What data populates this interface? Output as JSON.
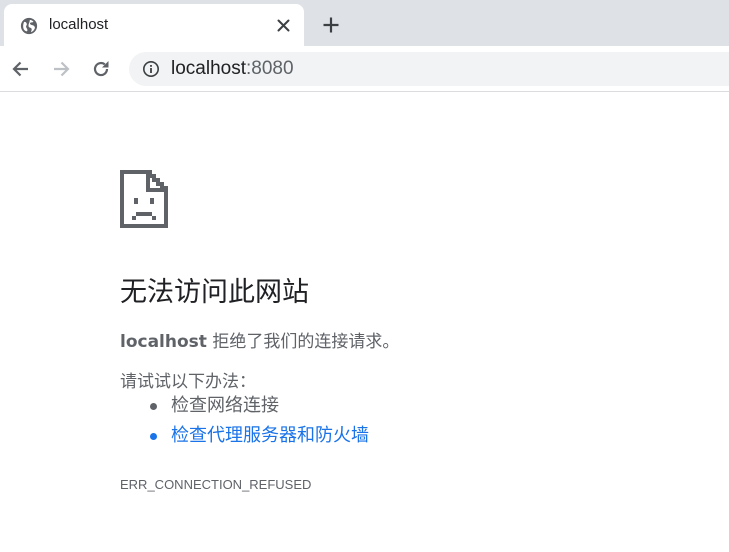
{
  "tab": {
    "title": "localhost",
    "favicon": "globe-icon",
    "close_icon": "close-icon"
  },
  "new_tab_icon": "plus-icon",
  "toolbar": {
    "back_icon": "arrow-left-icon",
    "forward_icon": "arrow-right-icon",
    "reload_icon": "reload-icon",
    "security_icon": "info-icon",
    "url_host": "localhost",
    "url_port": ":8080"
  },
  "error": {
    "icon": "sad-page-icon",
    "heading": "无法访问此网站",
    "host": "localhost",
    "summary_rest": " 拒绝了我们的连接请求。",
    "suggestions_intro": "请试试以下办法：",
    "suggestions": [
      {
        "text": "检查网络连接",
        "is_link": false
      },
      {
        "text": "检查代理服务器和防火墙",
        "is_link": true
      }
    ],
    "code": "ERR_CONNECTION_REFUSED"
  },
  "colors": {
    "tabstrip_bg": "#dee1e6",
    "text_primary": "#202124",
    "text_secondary": "#5f6368",
    "link": "#1a73e8",
    "omnibox_bg": "#f1f3f4"
  }
}
